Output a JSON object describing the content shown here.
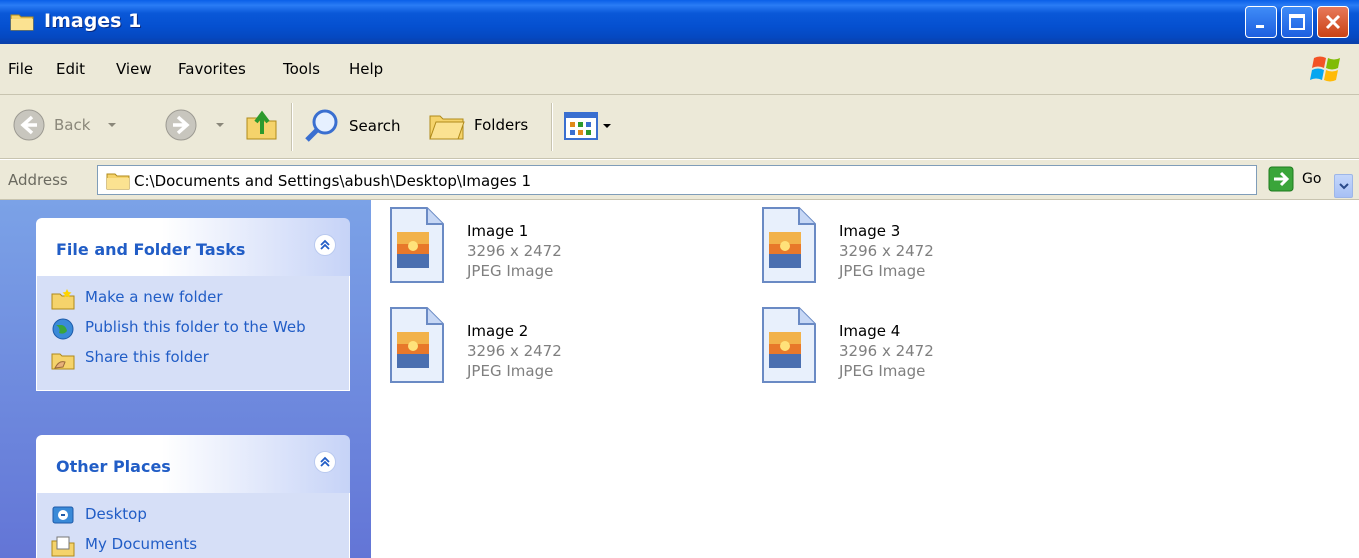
{
  "window": {
    "title": "Images 1"
  },
  "menu": [
    "File",
    "Edit",
    "View",
    "Favorites",
    "Tools",
    "Help"
  ],
  "toolbar": {
    "back_label": "Back",
    "search_label": "Search",
    "folders_label": "Folders"
  },
  "address": {
    "label": "Address",
    "value": "C:\\Documents and Settings\\abush\\Desktop\\Images 1",
    "go_label": "Go"
  },
  "tasks": {
    "title": "File and Folder Tasks",
    "items": [
      {
        "label": "Make a new folder",
        "icon": "new-folder-icon"
      },
      {
        "label": "Publish this folder to the Web",
        "icon": "globe-icon"
      },
      {
        "label": "Share this folder",
        "icon": "share-folder-icon"
      }
    ]
  },
  "places": {
    "title": "Other Places",
    "items": [
      {
        "label": "Desktop",
        "icon": "desktop-icon"
      },
      {
        "label": "My Documents",
        "icon": "my-documents-icon"
      }
    ]
  },
  "files": [
    {
      "name": "Image 1",
      "dimensions": "3296 x 2472",
      "type": "JPEG Image"
    },
    {
      "name": "Image 2",
      "dimensions": "3296 x 2472",
      "type": "JPEG Image"
    },
    {
      "name": "Image 3",
      "dimensions": "3296 x 2472",
      "type": "JPEG Image"
    },
    {
      "name": "Image 4",
      "dimensions": "3296 x 2472",
      "type": "JPEG Image"
    }
  ],
  "colors": {
    "title_bar": "#0550d0",
    "task_pane": "#6f8ee0",
    "link": "#215dc6",
    "chrome": "#ece9d8"
  }
}
